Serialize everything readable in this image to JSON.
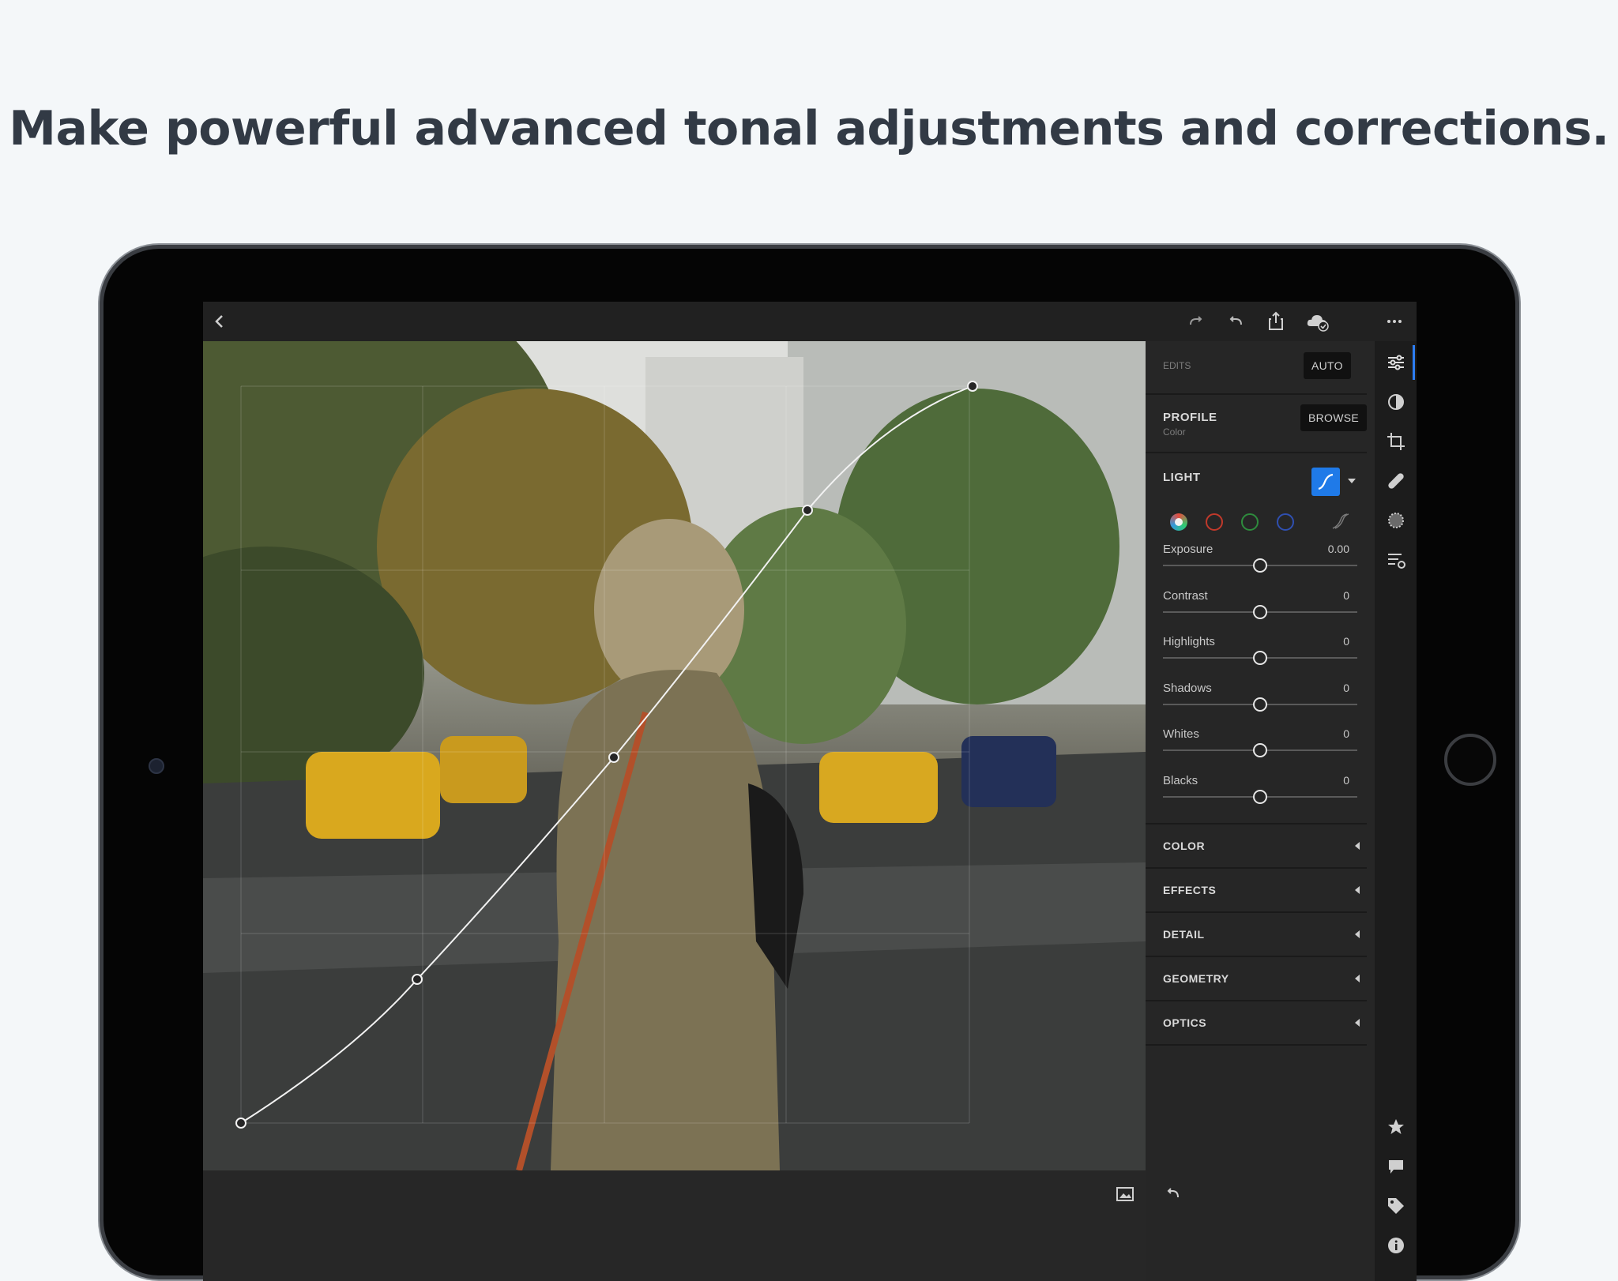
{
  "headline": "Make powerful advanced tonal adjustments and corrections.",
  "topbar": {
    "back_icon": "chevron-left-icon",
    "redo_icon": "redo-icon",
    "undo_icon": "undo-icon",
    "share_icon": "share-icon",
    "cloud_icon": "cloud-synced-icon",
    "more_icon": "more-icon"
  },
  "panel": {
    "edits_label": "EDITS",
    "auto_label": "AUTO",
    "profile_label": "PROFILE",
    "profile_value": "Color",
    "browse_label": "BROWSE",
    "light_label": "LIGHT",
    "sliders": [
      {
        "name": "Exposure",
        "value": "0.00",
        "level": 0.5
      },
      {
        "name": "Contrast",
        "value": "0",
        "level": 0.5
      },
      {
        "name": "Highlights",
        "value": "0",
        "level": 0.5
      },
      {
        "name": "Shadows",
        "value": "0",
        "level": 0.5
      },
      {
        "name": "Whites",
        "value": "0",
        "level": 0.5
      },
      {
        "name": "Blacks",
        "value": "0",
        "level": 0.5
      }
    ],
    "sections": [
      "COLOR",
      "EFFECTS",
      "DETAIL",
      "GEOMETRY",
      "OPTICS"
    ]
  },
  "colors": {
    "accent": "#1f7ae8",
    "channel_rgb": "#e8e8e8",
    "channel_red": "#c0392b",
    "channel_green": "#2e8b3d",
    "channel_blue": "#2f4fb0"
  },
  "rail_icons": [
    "edit-sliders-icon",
    "selective-icon",
    "crop-icon",
    "healing-icon",
    "vignette-icon",
    "presets-icon",
    "star-icon",
    "comment-icon",
    "tag-icon",
    "info-icon"
  ],
  "bottom_icons": [
    "compare-icon",
    "reset-icon"
  ]
}
